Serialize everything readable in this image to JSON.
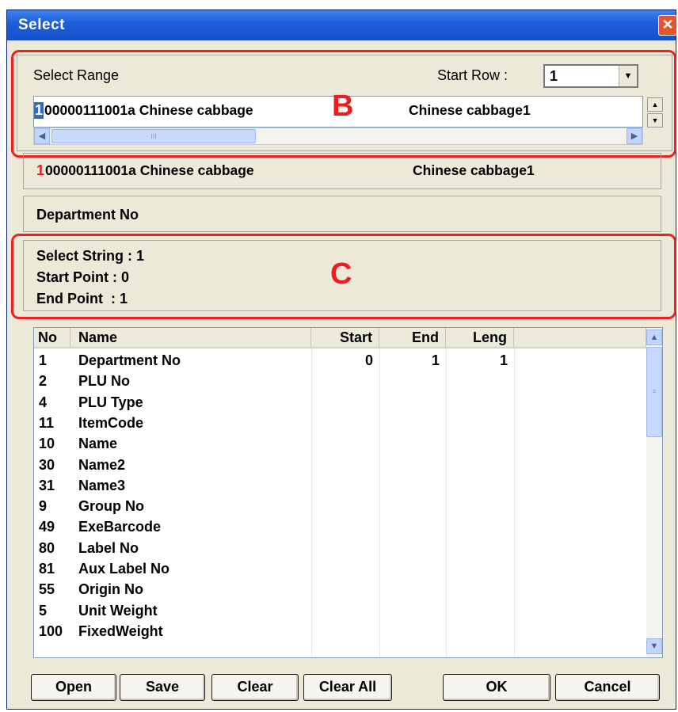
{
  "window": {
    "title": "Select",
    "close_glyph": "✕"
  },
  "select_range": {
    "label": "Select Range",
    "start_row_label": "Start Row :",
    "start_row_value": "1",
    "field_text_highlight": "1",
    "field_text_rest": "00000111001a Chinese cabbage",
    "field_text_right": "Chinese cabbage1",
    "scroll_thumb_glyph": "III"
  },
  "preview": {
    "first_char": "1",
    "rest": "00000111001a Chinese cabbage",
    "right": "Chinese cabbage1"
  },
  "field_name": "Department No",
  "selection_info": {
    "select_string": "Select String : 1",
    "start_point": "Start Point : 0",
    "end_point": "End Point  : 1"
  },
  "annotations": {
    "b": "B",
    "c": "C"
  },
  "table": {
    "columns": [
      "No",
      "Name",
      "Start",
      "End",
      "Leng"
    ],
    "rows": [
      {
        "no": "1",
        "name": "Department No",
        "start": "0",
        "end": "1",
        "leng": "1"
      },
      {
        "no": "2",
        "name": "PLU No",
        "start": "",
        "end": "",
        "leng": ""
      },
      {
        "no": "4",
        "name": "PLU Type",
        "start": "",
        "end": "",
        "leng": ""
      },
      {
        "no": "11",
        "name": "ItemCode",
        "start": "",
        "end": "",
        "leng": ""
      },
      {
        "no": "10",
        "name": "Name",
        "start": "",
        "end": "",
        "leng": ""
      },
      {
        "no": "30",
        "name": "Name2",
        "start": "",
        "end": "",
        "leng": ""
      },
      {
        "no": "31",
        "name": "Name3",
        "start": "",
        "end": "",
        "leng": ""
      },
      {
        "no": "9",
        "name": "Group No",
        "start": "",
        "end": "",
        "leng": ""
      },
      {
        "no": "49",
        "name": "ExeBarcode",
        "start": "",
        "end": "",
        "leng": ""
      },
      {
        "no": "80",
        "name": "Label No",
        "start": "",
        "end": "",
        "leng": ""
      },
      {
        "no": "81",
        "name": "Aux Label No",
        "start": "",
        "end": "",
        "leng": ""
      },
      {
        "no": "55",
        "name": "Origin No",
        "start": "",
        "end": "",
        "leng": ""
      },
      {
        "no": "5",
        "name": "Unit Weight",
        "start": "",
        "end": "",
        "leng": ""
      },
      {
        "no": "100",
        "name": "FixedWeight",
        "start": "",
        "end": "",
        "leng": ""
      }
    ]
  },
  "buttons": {
    "open": "Open",
    "save": "Save",
    "clear": "Clear",
    "clear_all": "Clear All",
    "ok": "OK",
    "cancel": "Cancel"
  }
}
